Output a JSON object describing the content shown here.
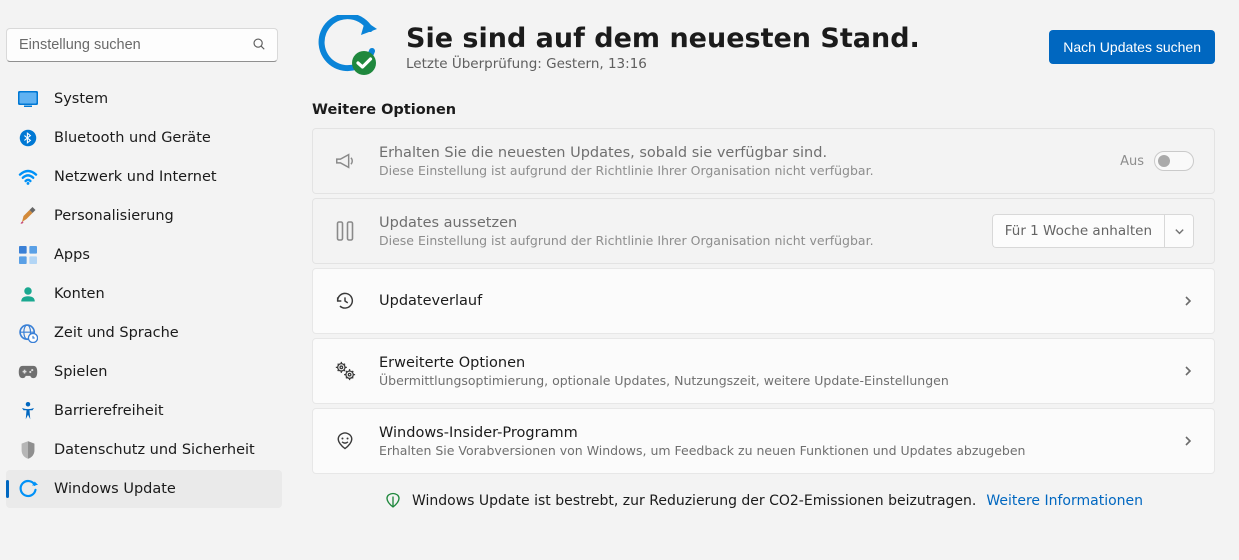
{
  "search": {
    "placeholder": "Einstellung suchen"
  },
  "sidebar": {
    "items": [
      {
        "id": "system",
        "label": "System"
      },
      {
        "id": "bluetooth",
        "label": "Bluetooth und Geräte"
      },
      {
        "id": "network",
        "label": "Netzwerk und Internet"
      },
      {
        "id": "personalization",
        "label": "Personalisierung"
      },
      {
        "id": "apps",
        "label": "Apps"
      },
      {
        "id": "accounts",
        "label": "Konten"
      },
      {
        "id": "timelang",
        "label": "Zeit und Sprache"
      },
      {
        "id": "gaming",
        "label": "Spielen"
      },
      {
        "id": "accessibility",
        "label": "Barrierefreiheit"
      },
      {
        "id": "privacy",
        "label": "Datenschutz und Sicherheit"
      },
      {
        "id": "update",
        "label": "Windows Update"
      }
    ]
  },
  "status": {
    "title": "Sie sind auf dem neuesten Stand.",
    "sub": "Letzte Überprüfung: Gestern, 13:16",
    "check_button": "Nach Updates suchen"
  },
  "section_title": "Weitere Optionen",
  "rows": {
    "latest": {
      "title": "Erhalten Sie die neuesten Updates, sobald sie verfügbar sind.",
      "sub": "Diese Einstellung ist aufgrund der Richtlinie Ihrer Organisation nicht verfügbar.",
      "toggle_label": "Aus"
    },
    "pause": {
      "title": "Updates aussetzen",
      "sub": "Diese Einstellung ist aufgrund der Richtlinie Ihrer Organisation nicht verfügbar.",
      "dropdown_label": "Für 1 Woche anhalten"
    },
    "history": {
      "title": "Updateverlauf"
    },
    "advanced": {
      "title": "Erweiterte Optionen",
      "sub": "Übermittlungsoptimierung, optionale Updates, Nutzungszeit, weitere Update-Einstellungen"
    },
    "insider": {
      "title": "Windows-Insider-Programm",
      "sub": "Erhalten Sie Vorabversionen von Windows, um Feedback zu neuen Funktionen und Updates abzugeben"
    }
  },
  "co2": {
    "text": "Windows Update ist bestrebt, zur Reduzierung der CO2-Emissionen beizutragen.",
    "link": "Weitere Informationen"
  }
}
